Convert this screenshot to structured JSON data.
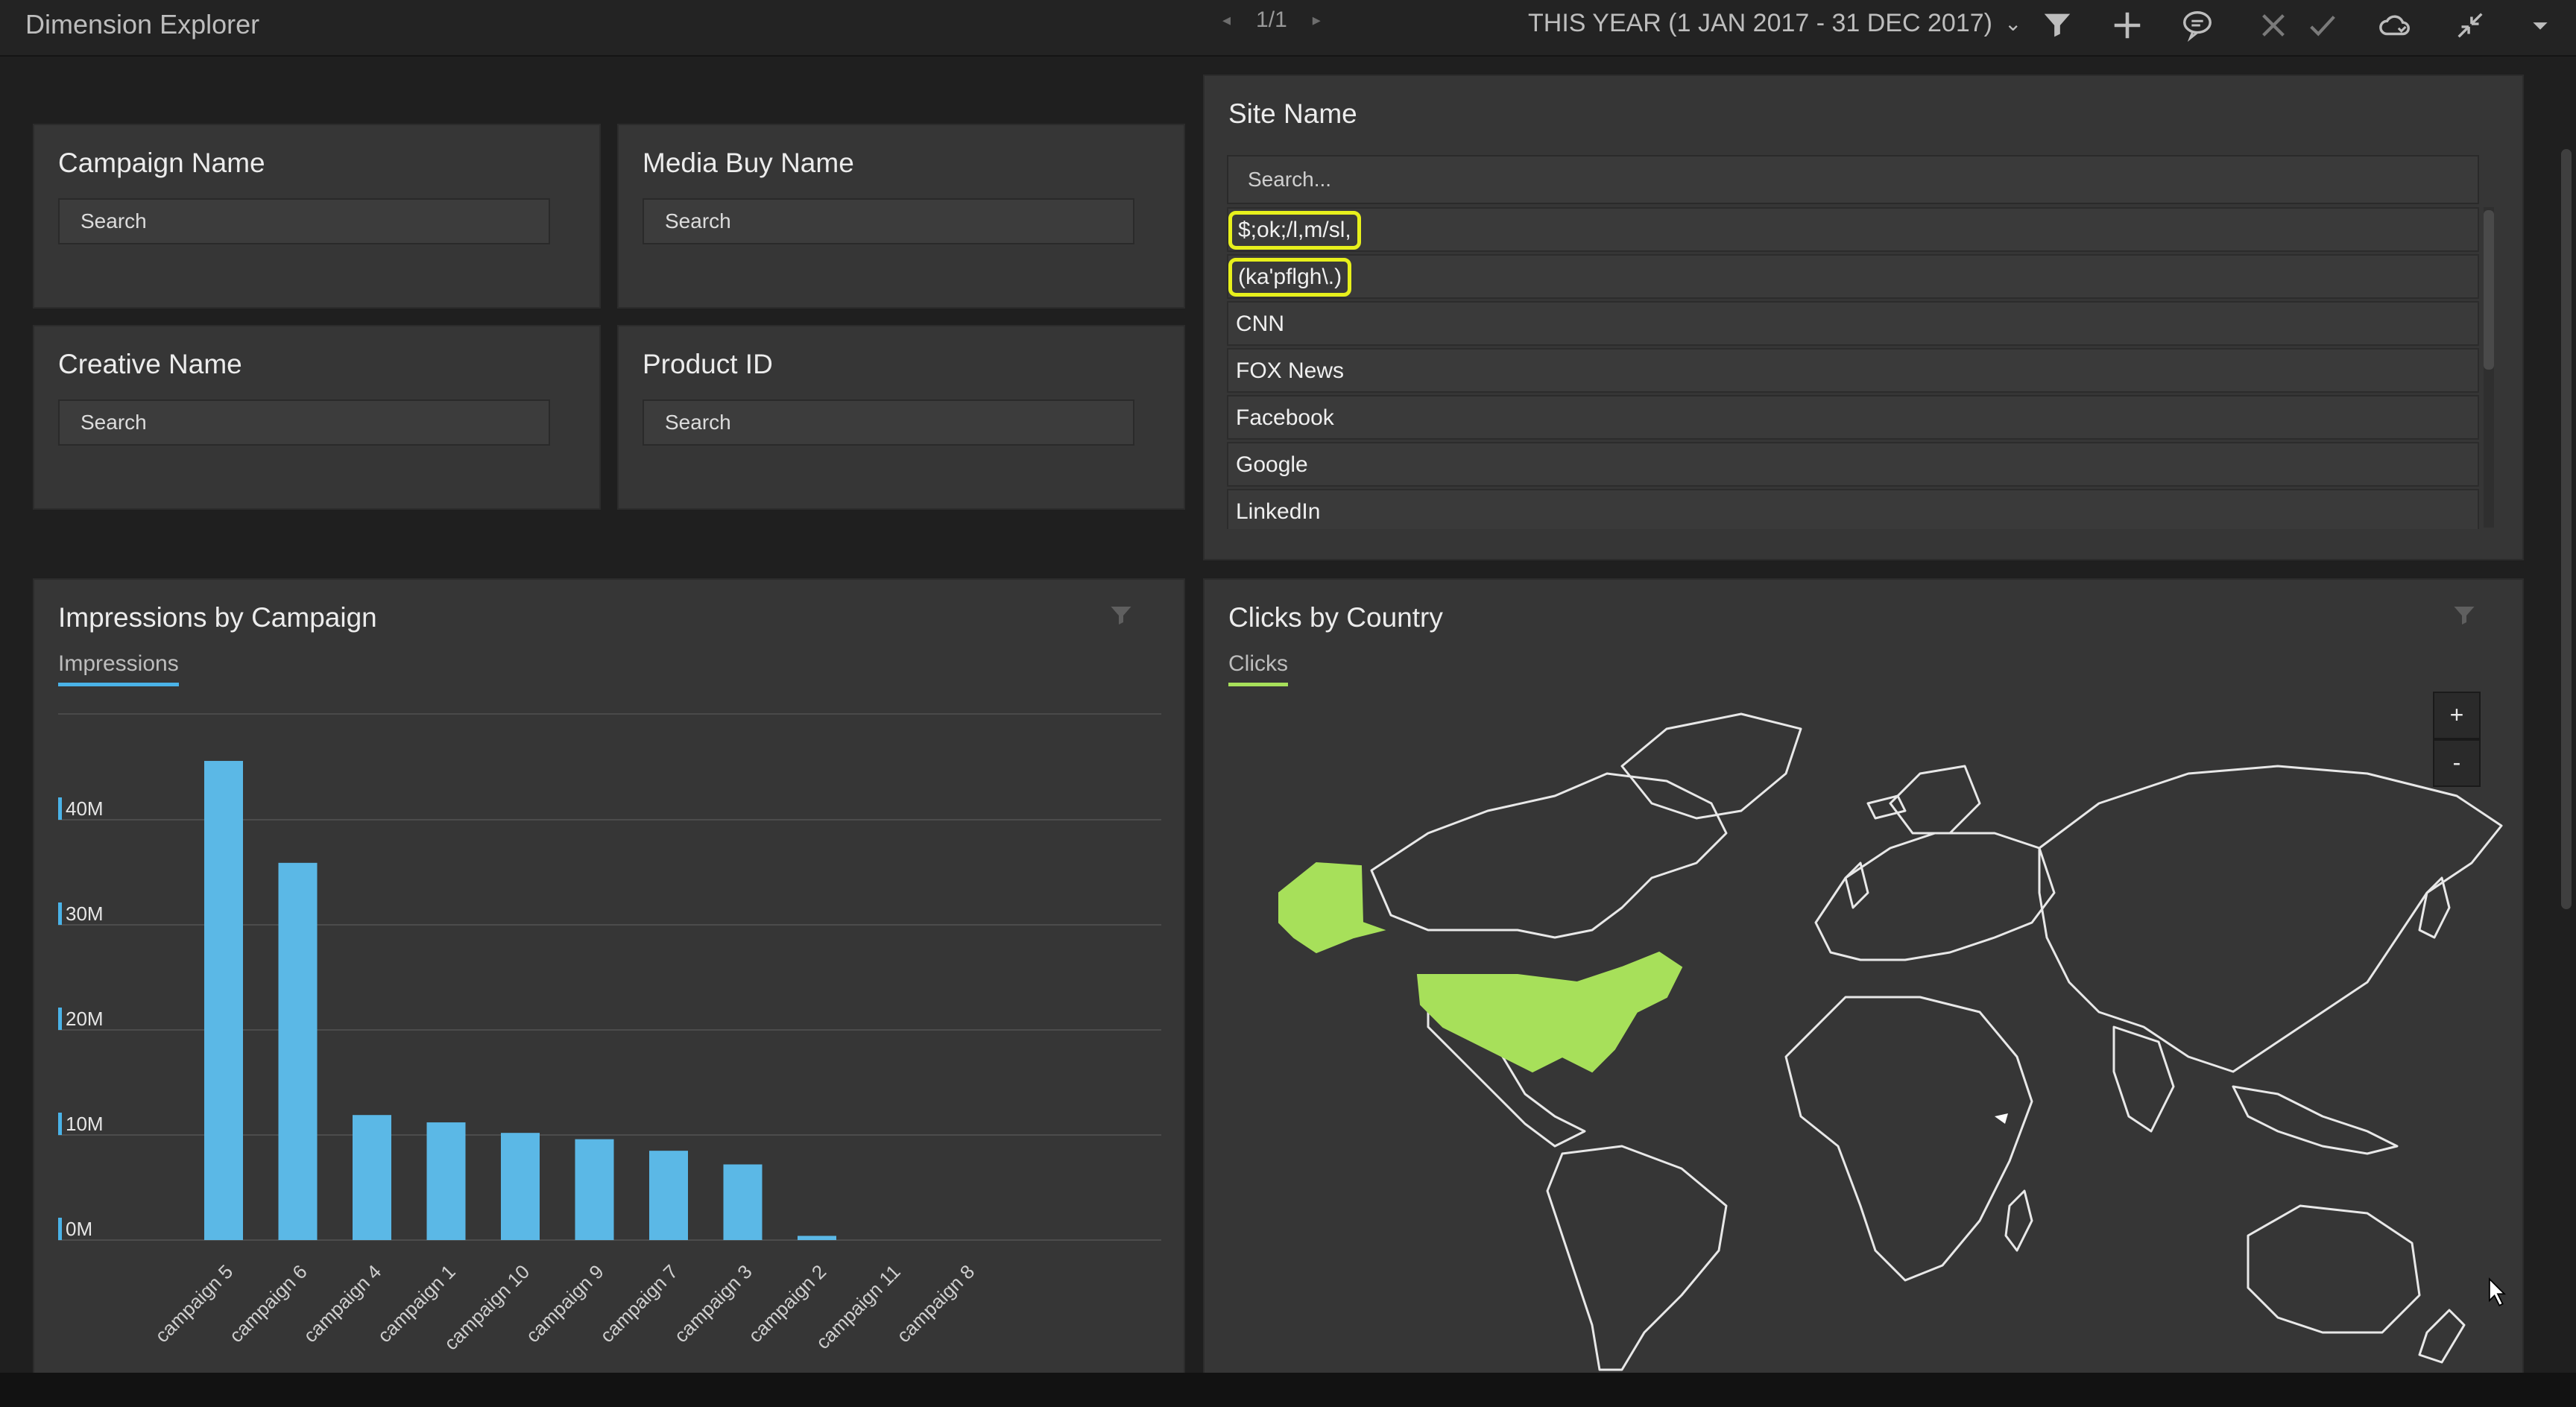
{
  "app": {
    "title": "Dimension Explorer"
  },
  "pager": {
    "label": "1/1"
  },
  "date_range": {
    "label": "THIS YEAR (1 JAN 2017 - 31 DEC 2017)"
  },
  "toolbar_icons": [
    "filter-icon",
    "plus-icon",
    "comment-icon",
    "close-icon",
    "check-icon",
    "cloud-sync-icon",
    "collapse-icon",
    "dropdown-icon"
  ],
  "filters": {
    "campaign": {
      "title": "Campaign Name",
      "placeholder": "Search"
    },
    "media_buy": {
      "title": "Media Buy Name",
      "placeholder": "Search"
    },
    "creative": {
      "title": "Creative Name",
      "placeholder": "Search"
    },
    "product": {
      "title": "Product ID",
      "placeholder": "Search"
    }
  },
  "site_name": {
    "title": "Site Name",
    "placeholder": "Search...",
    "items": [
      "$;ok;/l,m/sl,",
      "(ka'pflgh\\.)",
      "CNN",
      "FOX News",
      "Facebook",
      "Google",
      "LinkedIn"
    ],
    "highlight_color": "#e7f01c"
  },
  "impressions": {
    "title": "Impressions by Campaign",
    "tab": "Impressions",
    "accent": "#4ab3e8"
  },
  "clicks": {
    "title": "Clicks by Country",
    "tab": "Clicks",
    "accent": "#a7e05a",
    "zoom_in": "+",
    "zoom_out": "-",
    "highlighted_countries": [
      "United States"
    ]
  },
  "chart_data": {
    "type": "bar",
    "categories": [
      "campaign 5",
      "campaign 6",
      "campaign 4",
      "campaign 1",
      "campaign 10",
      "campaign 9",
      "campaign 7",
      "campaign 3",
      "campaign 2",
      "campaign 11",
      "campaign 8"
    ],
    "values": [
      45.6,
      35.9,
      11.9,
      11.2,
      10.2,
      9.6,
      8.5,
      7.2,
      0.4,
      0,
      0
    ],
    "units": "M",
    "yticks": [
      "0M",
      "10M",
      "20M",
      "30M",
      "40M"
    ],
    "ylim": [
      0,
      50
    ],
    "grid": true,
    "color": "#5bb8e6"
  }
}
